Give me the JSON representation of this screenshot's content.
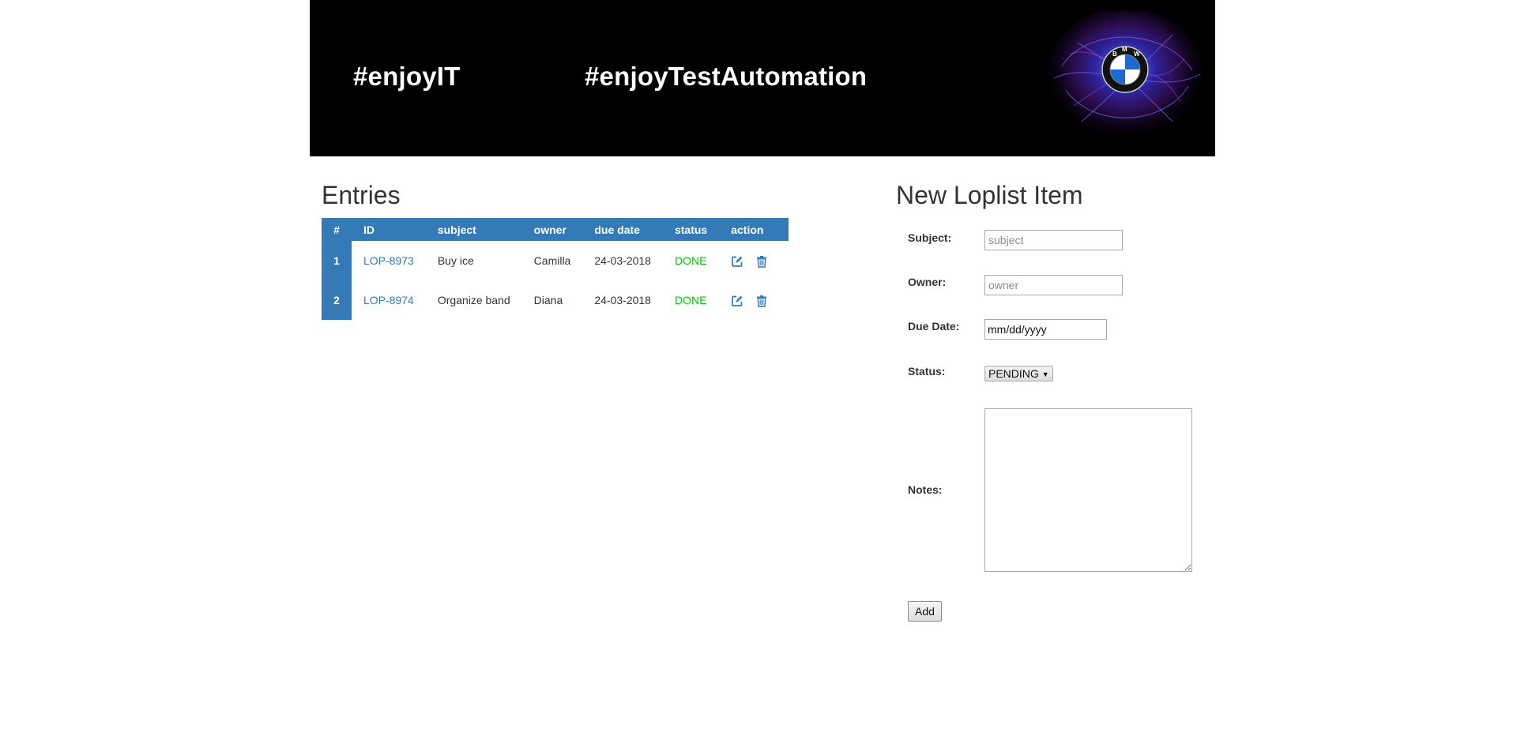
{
  "header": {
    "tagline_left": "#enjoyIT",
    "tagline_right": "#enjoyTestAutomation",
    "logo_letters": "BMW"
  },
  "entries": {
    "title": "Entries",
    "columns": [
      "#",
      "ID",
      "subject",
      "owner",
      "due date",
      "status",
      "action"
    ],
    "rows": [
      {
        "num": "1",
        "id": "LOP-8973",
        "subject": "Buy ice",
        "owner": "Camilla",
        "due": "24-03-2018",
        "status": "DONE"
      },
      {
        "num": "2",
        "id": "LOP-8974",
        "subject": "Organize band",
        "owner": "Diana",
        "due": "24-03-2018",
        "status": "DONE"
      }
    ],
    "actions": [
      "edit-icon",
      "delete-icon"
    ]
  },
  "form": {
    "title": "New Loplist Item",
    "subject_label": "Subject:",
    "subject_placeholder": "subject",
    "owner_label": "Owner:",
    "owner_placeholder": "owner",
    "due_label": "Due Date:",
    "due_value": "mm/dd/yyyy",
    "status_label": "Status:",
    "status_value": "PENDING",
    "notes_label": "Notes:",
    "add_label": "Add"
  },
  "colors": {
    "header_bg": "#000000",
    "table_header_bg": "#337ab7",
    "link": "#337ab7",
    "status_done": "#00c800"
  }
}
